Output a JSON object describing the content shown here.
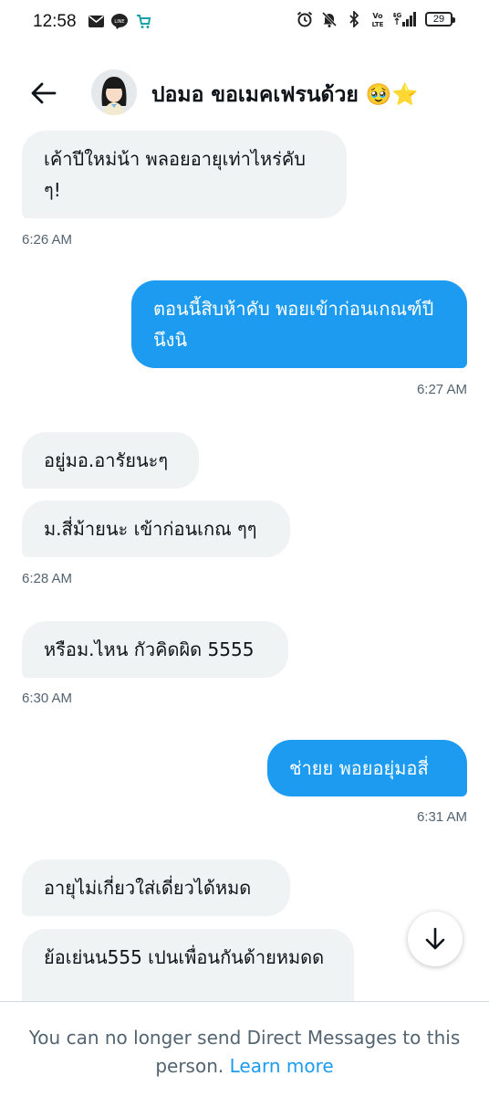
{
  "status_bar": {
    "time": "12:58",
    "left_icons": [
      "gmail-icon",
      "line-icon",
      "shop-icon"
    ],
    "right_icons": [
      "alarm-icon",
      "mute-icon",
      "bluetooth-icon",
      "volte-icon",
      "4g-signal-icon"
    ],
    "battery": "29"
  },
  "header": {
    "title": "ปอมอ ขอเมคเฟรนด้วย 🥹⭐"
  },
  "messages": [
    {
      "dir": "in",
      "text": "เค้าปีใหม่น้า พลอยอายุเท่าไหร่คับ ๆ!"
    },
    {
      "dir": "in",
      "time": "6:26 AM"
    },
    {
      "dir": "out",
      "text": "ตอนนี้สิบห้าคับ พอยเข้าก่อนเกณฑ์ปีนึงนิ"
    },
    {
      "dir": "out",
      "time": "6:27 AM"
    },
    {
      "dir": "in",
      "text": "อยู่มอ.อารัยนะๆ"
    },
    {
      "dir": "in",
      "text": "ม.สี่ม้ายนะ เข้าก่อนเกณ ๆๆ"
    },
    {
      "dir": "in",
      "time": "6:28 AM"
    },
    {
      "dir": "in",
      "text": "หรือม.ไหน กัวคิดผิด 5555"
    },
    {
      "dir": "in",
      "time": "6:30 AM"
    },
    {
      "dir": "out",
      "text": "ช่ายย พอยอยุ่มอสี่"
    },
    {
      "dir": "out",
      "time": "6:31 AM"
    },
    {
      "dir": "in",
      "text": "อายุไม่เกี่ยวใส่เดี่ยวได้หมด"
    },
    {
      "dir": "in",
      "text": "ย้อเย่นน555 เปนเพื่อนกันด้ายหมดด"
    }
  ],
  "footer": {
    "notice": "You can no longer send Direct Messages to this person. ",
    "link": "Learn more"
  },
  "colors": {
    "accent": "#1d9bf0",
    "incoming_bubble": "#eff3f4",
    "secondary_text": "#536471"
  }
}
